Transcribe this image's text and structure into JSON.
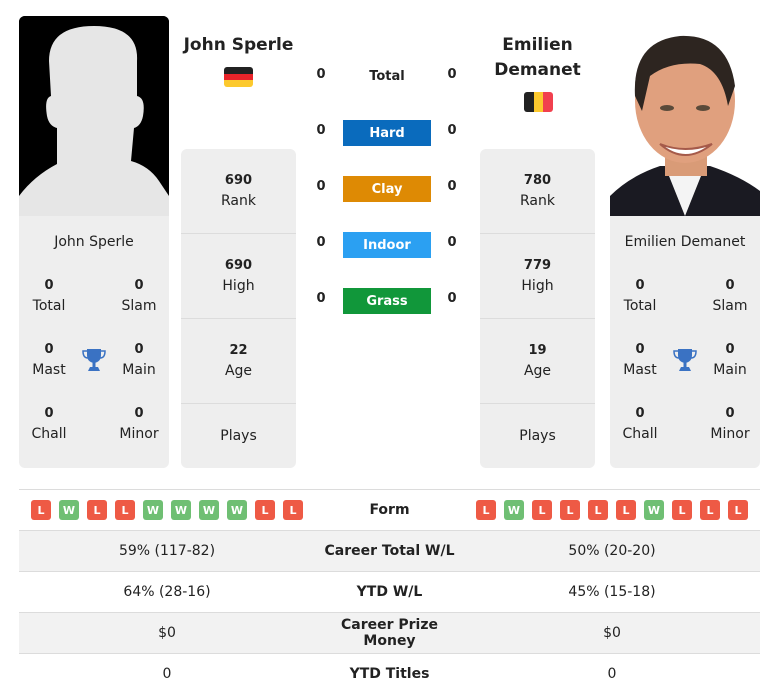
{
  "colors": {
    "hard": "#0a6bbd",
    "clay": "#de8a04",
    "indoor": "#2ba0f2",
    "grass": "#11973a",
    "loss": "#ee5a45",
    "win": "#6fbf73",
    "trophy": "#3a72c3"
  },
  "player1": {
    "name": "John Sperle",
    "flag": "germany-flag",
    "rank": "690",
    "rank_label": "Rank",
    "high": "690",
    "high_label": "High",
    "age": "22",
    "age_label": "Age",
    "plays_label": "Plays",
    "titles": {
      "total": "0",
      "total_label": "Total",
      "slam": "0",
      "slam_label": "Slam",
      "mast": "0",
      "mast_label": "Mast",
      "main": "0",
      "main_label": "Main",
      "chall": "0",
      "chall_label": "Chall",
      "minor": "0",
      "minor_label": "Minor"
    },
    "form": [
      "L",
      "W",
      "L",
      "L",
      "W",
      "W",
      "W",
      "W",
      "L",
      "L"
    ]
  },
  "player2": {
    "name_line1": "Emilien",
    "name_line2": "Demanet",
    "name": "Emilien Demanet",
    "flag": "belgium-flag",
    "rank": "780",
    "rank_label": "Rank",
    "high": "779",
    "high_label": "High",
    "age": "19",
    "age_label": "Age",
    "plays_label": "Plays",
    "titles": {
      "total": "0",
      "total_label": "Total",
      "slam": "0",
      "slam_label": "Slam",
      "mast": "0",
      "mast_label": "Mast",
      "main": "0",
      "main_label": "Main",
      "chall": "0",
      "chall_label": "Chall",
      "minor": "0",
      "minor_label": "Minor"
    },
    "form": [
      "L",
      "W",
      "L",
      "L",
      "L",
      "L",
      "W",
      "L",
      "L",
      "L"
    ]
  },
  "h2h": {
    "total": {
      "label": "Total",
      "p1": "0",
      "p2": "0"
    },
    "hard": {
      "label": "Hard",
      "p1": "0",
      "p2": "0"
    },
    "clay": {
      "label": "Clay",
      "p1": "0",
      "p2": "0"
    },
    "indoor": {
      "label": "Indoor",
      "p1": "0",
      "p2": "0"
    },
    "grass": {
      "label": "Grass",
      "p1": "0",
      "p2": "0"
    }
  },
  "comparison": {
    "form_label": "Form",
    "rows": [
      {
        "label": "Career Total W/L",
        "p1": "59% (117-82)",
        "p2": "50% (20-20)"
      },
      {
        "label": "YTD W/L",
        "p1": "64% (28-16)",
        "p2": "45% (15-18)"
      },
      {
        "label": "Career Prize Money",
        "p1": "$0",
        "p2": "$0"
      },
      {
        "label": "YTD Titles",
        "p1": "0",
        "p2": "0"
      }
    ]
  }
}
